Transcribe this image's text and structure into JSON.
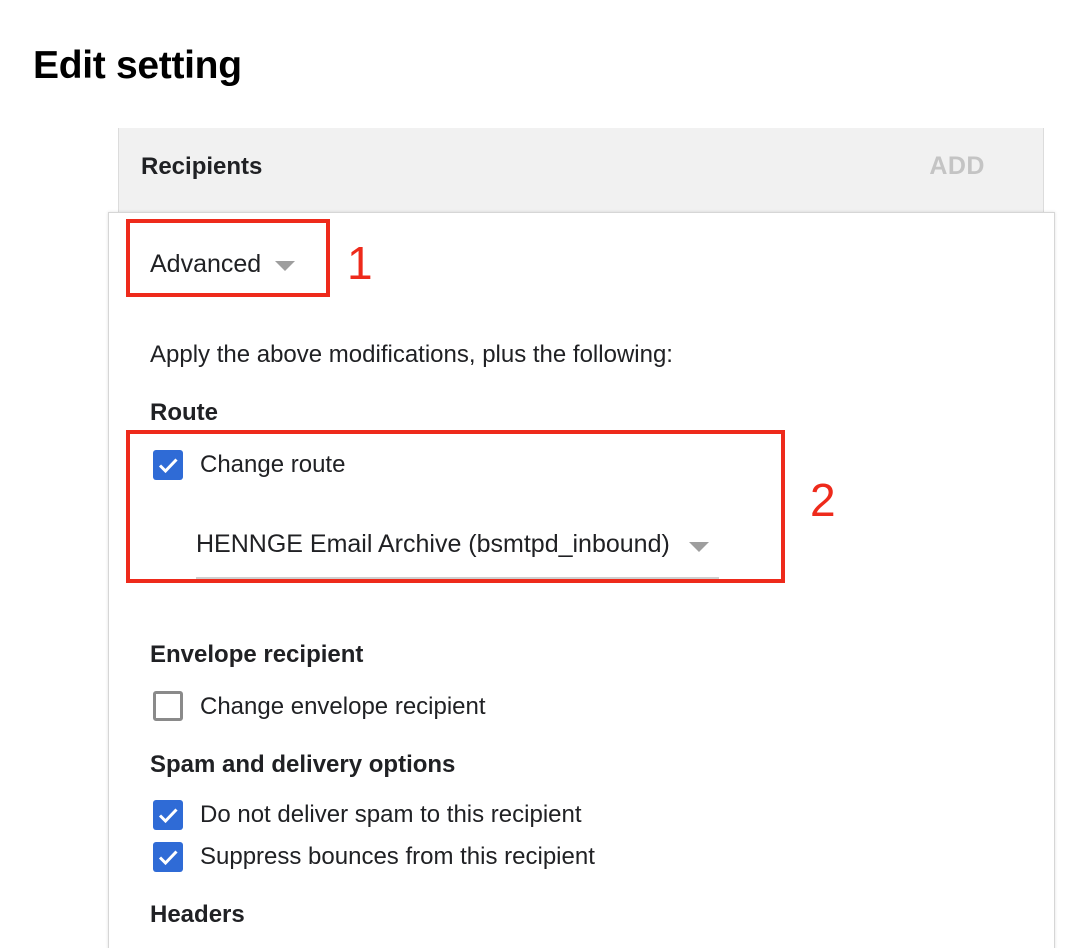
{
  "page": {
    "title": "Edit setting"
  },
  "recipients": {
    "label": "Recipients",
    "add_label": "ADD"
  },
  "mode_select": {
    "value": "Advanced"
  },
  "callouts": {
    "one": "1",
    "two": "2"
  },
  "intro_text": "Apply the above modifications, plus the following:",
  "route": {
    "heading": "Route",
    "change_route": {
      "label": "Change route",
      "checked": true
    },
    "select_value": "HENNGE Email Archive (bsmtpd_inbound)"
  },
  "envelope": {
    "heading": "Envelope recipient",
    "change_envelope": {
      "label": "Change envelope recipient",
      "checked": false
    }
  },
  "spam": {
    "heading": "Spam and delivery options",
    "no_spam": {
      "label": "Do not deliver spam to this recipient",
      "checked": true
    },
    "suppress_bounces": {
      "label": "Suppress bounces from this recipient",
      "checked": true
    }
  },
  "headers": {
    "heading": "Headers"
  },
  "colors": {
    "checkbox_checked": "#2f6bd6",
    "callout": "#ee2a1b"
  }
}
